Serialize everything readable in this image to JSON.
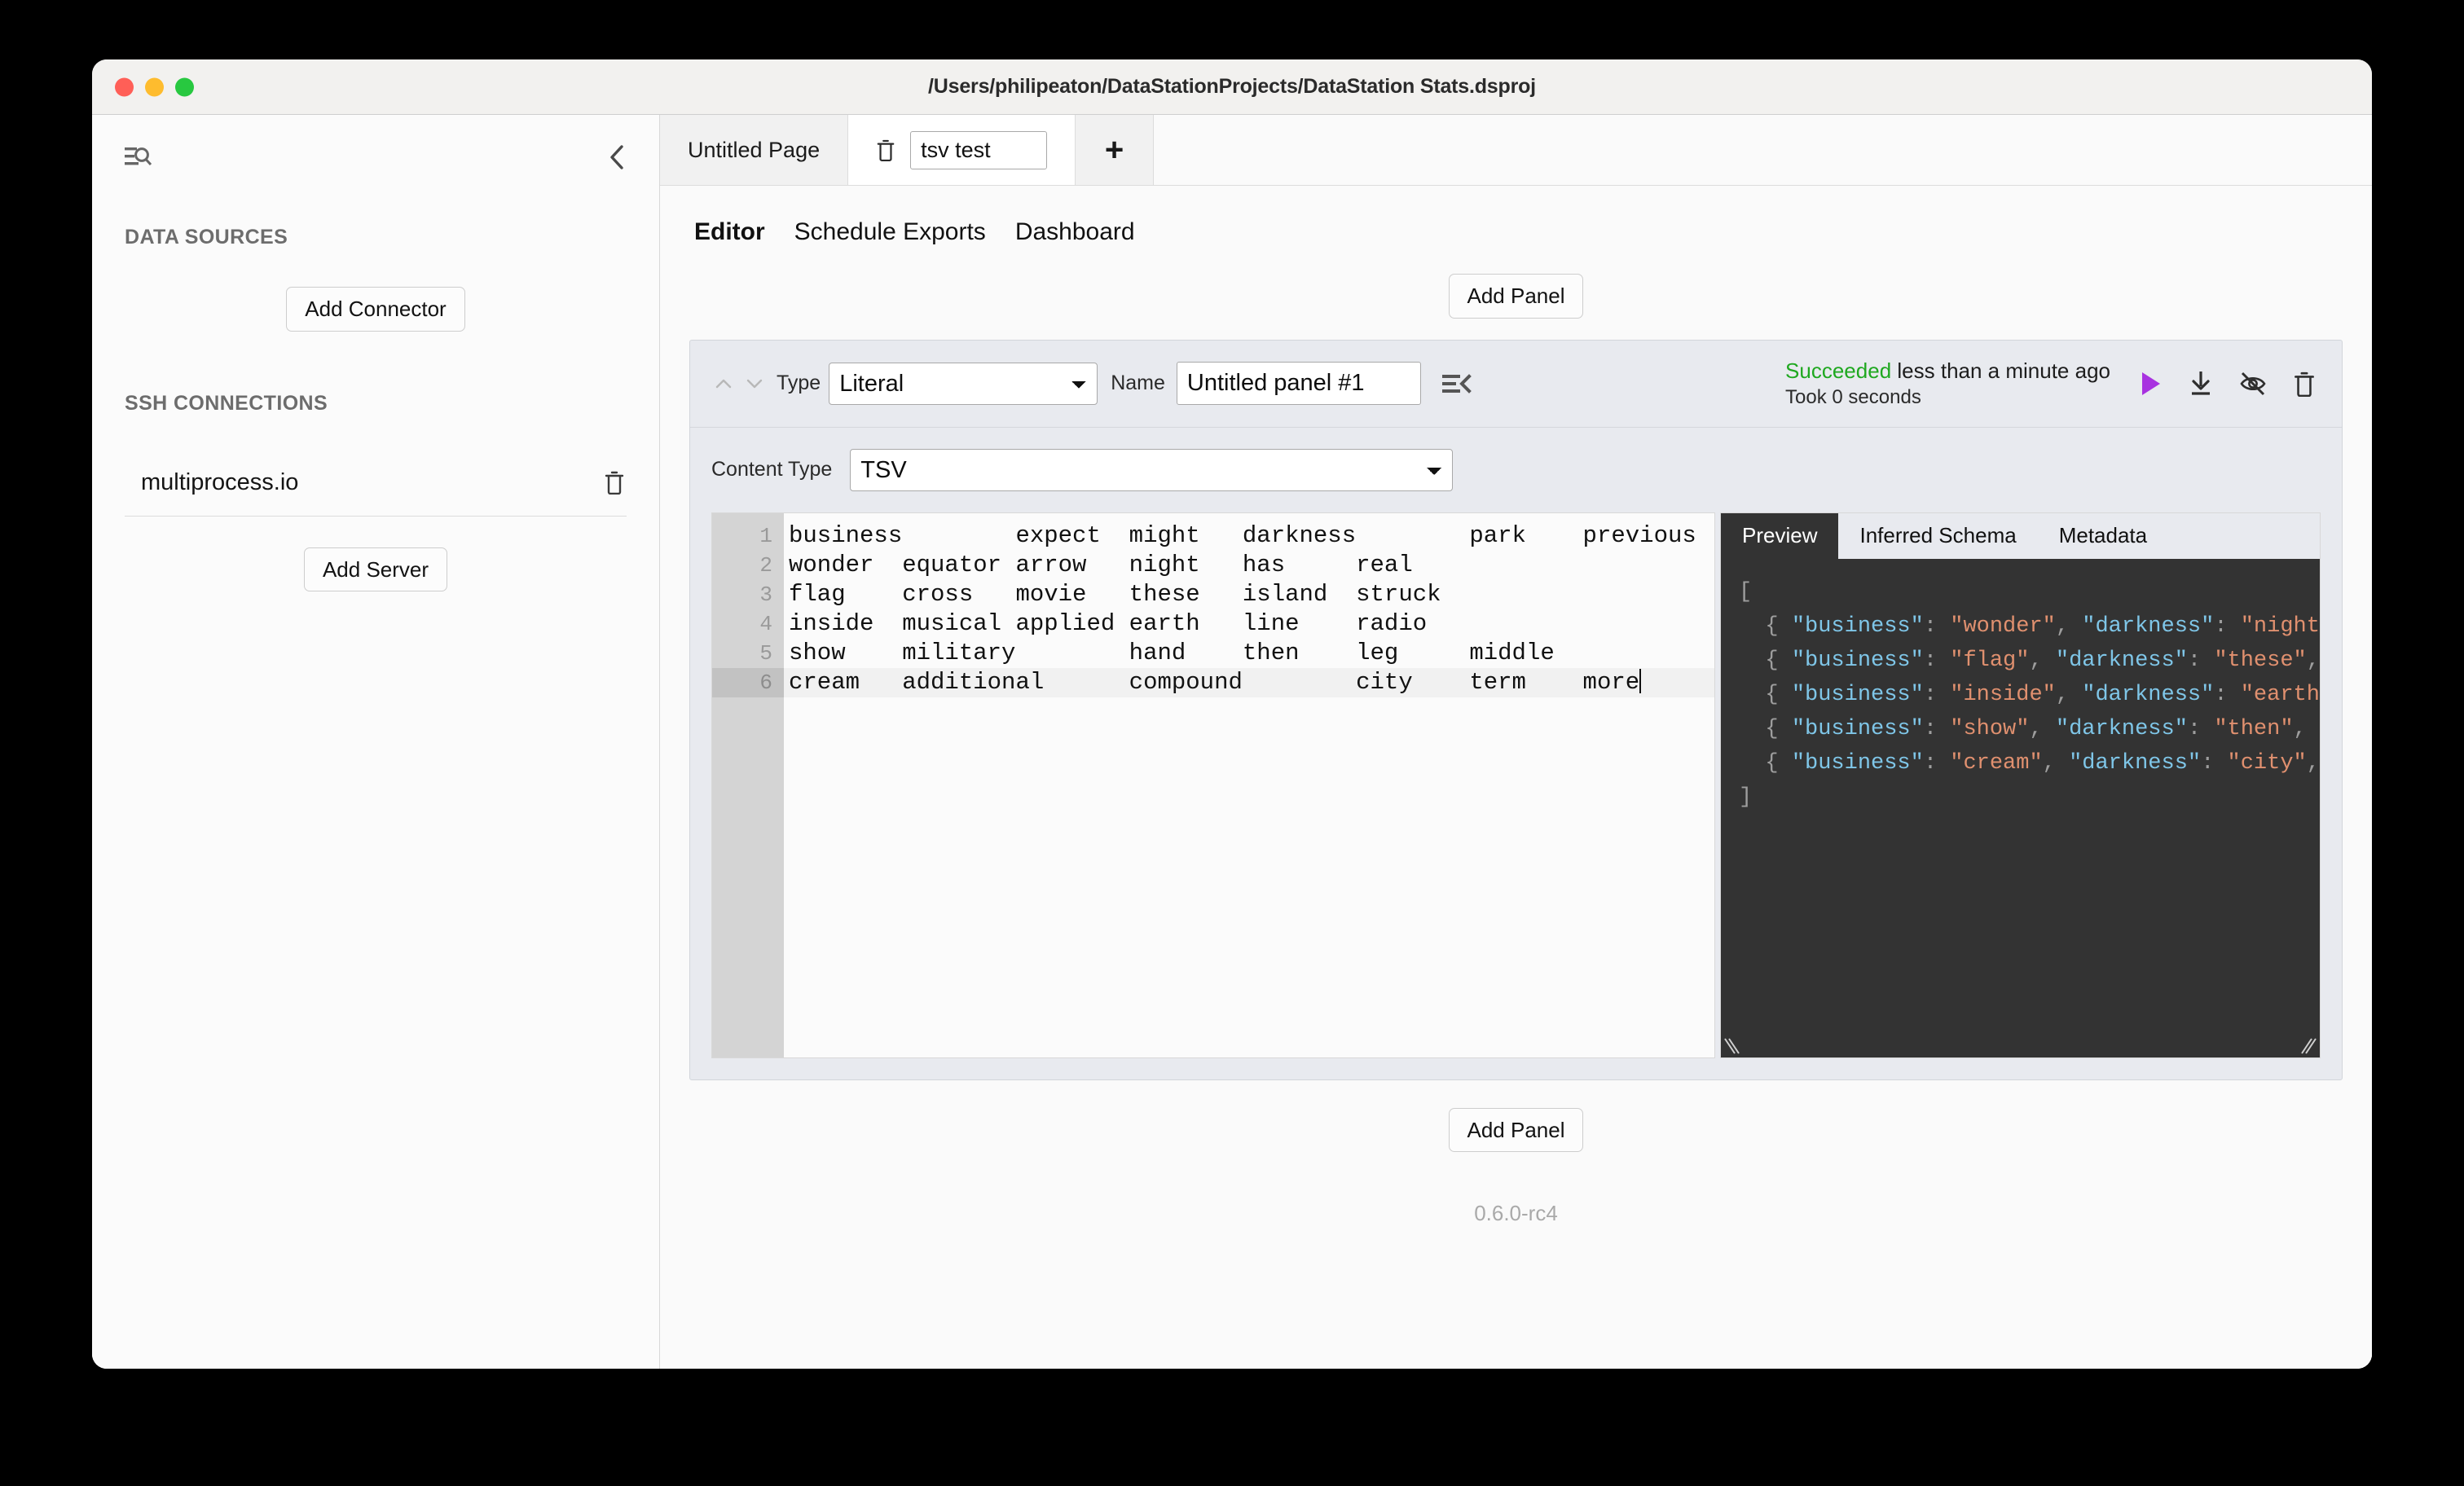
{
  "window": {
    "title": "/Users/philipeaton/DataStationProjects/DataStation Stats.dsproj"
  },
  "sidebar": {
    "search_icon": "search-list-icon",
    "collapse_icon": "chevron-left-icon",
    "sections": [
      {
        "heading": "DATA SOURCES",
        "button": "Add Connector"
      },
      {
        "heading": "SSH CONNECTIONS",
        "button": "Add Server"
      }
    ],
    "connections": [
      {
        "name": "multiprocess.io",
        "delete_icon": "trash-icon"
      }
    ]
  },
  "tabstrip": {
    "tabs": [
      {
        "label": "Untitled Page",
        "active": false
      },
      {
        "label": "tsv test",
        "active": true,
        "delete_icon": "trash-icon"
      }
    ],
    "add_label": "+"
  },
  "nav": {
    "tabs": [
      {
        "label": "Editor",
        "active": true
      },
      {
        "label": "Schedule Exports",
        "active": false
      },
      {
        "label": "Dashboard",
        "active": false
      }
    ]
  },
  "buttons": {
    "add_panel_top": "Add Panel",
    "add_panel_bottom": "Add Panel"
  },
  "panel": {
    "move_up_icon": "chevron-up-icon",
    "move_down_icon": "chevron-down-icon",
    "type_label": "Type",
    "type_value": "Literal",
    "type_options": [
      "Literal"
    ],
    "name_label": "Name",
    "name_value": "Untitled panel #1",
    "collapse_icon": "collapse-panel-icon",
    "status_state": "Succeeded",
    "status_when": " less than a minute ago",
    "status_took": "Took 0 seconds",
    "status_color": "#1fa820",
    "actions": [
      {
        "icon": "play-icon",
        "color": "#a832e0"
      },
      {
        "icon": "download-icon",
        "color": "#303030"
      },
      {
        "icon": "eye-off-icon",
        "color": "#303030"
      },
      {
        "icon": "trash-icon",
        "color": "#303030"
      }
    ],
    "content_type_label": "Content Type",
    "content_type_value": "TSV",
    "content_type_options": [
      "TSV"
    ]
  },
  "editor": {
    "line_numbers": [
      "1",
      "2",
      "3",
      "4",
      "5",
      "6"
    ],
    "active_line": 6,
    "lines": [
      "business\texpect\tmight\tdarkness\tpark\tprevious",
      "wonder\tequator\tarrow\tnight\thas\treal",
      "flag\tcross\tmovie\tthese\tisland\tstruck",
      "inside\tmusical\tapplied\tearth\tline\tradio",
      "show\tmilitary\thand\tthen\tleg\tmiddle",
      "cream\tadditional\tcompound\tcity\tterm\tmore"
    ]
  },
  "preview": {
    "tabs": [
      {
        "label": "Preview",
        "active": true
      },
      {
        "label": "Inferred Schema",
        "active": false
      },
      {
        "label": "Metadata",
        "active": false
      }
    ],
    "lines": [
      {
        "punct_open": "[",
        "key1": "",
        "val1": "",
        "key2": "",
        "val2": ""
      },
      {
        "punct_open": "  { ",
        "key1": "\"business\"",
        "sep1": ": ",
        "val1": "\"wonder\"",
        "comma1": ", ",
        "key2": "\"darkness\"",
        "sep2": ": ",
        "val2": "\"night"
      },
      {
        "punct_open": "  { ",
        "key1": "\"business\"",
        "sep1": ": ",
        "val1": "\"flag\"",
        "comma1": ", ",
        "key2": "\"darkness\"",
        "sep2": ": ",
        "val2": "\"these\"",
        "tail": ","
      },
      {
        "punct_open": "  { ",
        "key1": "\"business\"",
        "sep1": ": ",
        "val1": "\"inside\"",
        "comma1": ", ",
        "key2": "\"darkness\"",
        "sep2": ": ",
        "val2": "\"earth"
      },
      {
        "punct_open": "  { ",
        "key1": "\"business\"",
        "sep1": ": ",
        "val1": "\"show\"",
        "comma1": ", ",
        "key2": "\"darkness\"",
        "sep2": ": ",
        "val2": "\"then\"",
        "tail": ","
      },
      {
        "punct_open": "  { ",
        "key1": "\"business\"",
        "sep1": ": ",
        "val1": "\"cream\"",
        "comma1": ", ",
        "key2": "\"darkness\"",
        "sep2": ": ",
        "val2": "\"city\"",
        "tail": ","
      },
      {
        "punct_open": "]",
        "key1": "",
        "val1": "",
        "key2": "",
        "val2": ""
      }
    ]
  },
  "footer": {
    "version": "0.6.0-rc4"
  }
}
